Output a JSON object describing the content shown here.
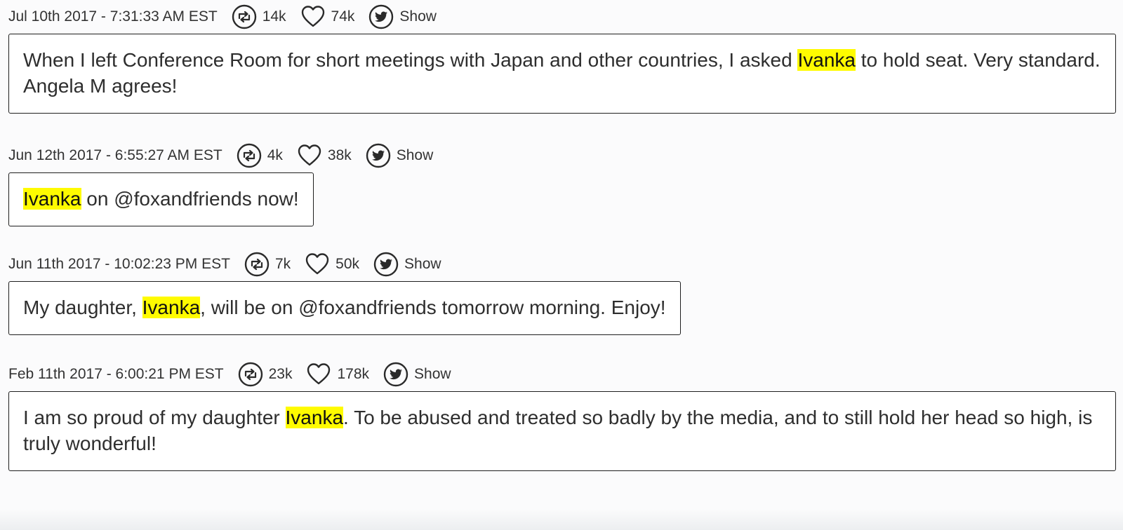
{
  "tweets": [
    {
      "date": "Jul 10th 2017 - 7:31:33 AM EST",
      "retweets": "14k",
      "likes": "74k",
      "show_label": "Show",
      "text_before": "When I left Conference Room for short meetings with Japan and other countries, I asked ",
      "highlight": "Ivanka",
      "text_after": " to hold seat. Very standard. Angela M agrees!"
    },
    {
      "date": "Jun 12th 2017 - 6:55:27 AM EST",
      "retweets": "4k",
      "likes": "38k",
      "show_label": "Show",
      "text_before": "",
      "highlight": "Ivanka",
      "text_after": " on @foxandfriends now!"
    },
    {
      "date": "Jun 11th 2017 - 10:02:23 PM EST",
      "retweets": "7k",
      "likes": "50k",
      "show_label": "Show",
      "text_before": "My daughter, ",
      "highlight": "Ivanka",
      "text_after": ", will be on @foxandfriends tomorrow morning. Enjoy!"
    },
    {
      "date": "Feb 11th 2017 - 6:00:21 PM EST",
      "retweets": "23k",
      "likes": "178k",
      "show_label": "Show",
      "text_before": "I am so proud of my daughter ",
      "highlight": "Ivanka",
      "text_after": ". To be abused and treated so badly by the media, and to still hold her head so high, is truly wonderful!"
    }
  ],
  "icons": {
    "retweet": "retweet-icon",
    "like": "heart-icon",
    "show": "twitter-bird-icon"
  },
  "colors": {
    "highlight": "#fffb00",
    "text": "#2e2e2e",
    "border": "#1e1e1e",
    "background": "#fbfbfc"
  }
}
